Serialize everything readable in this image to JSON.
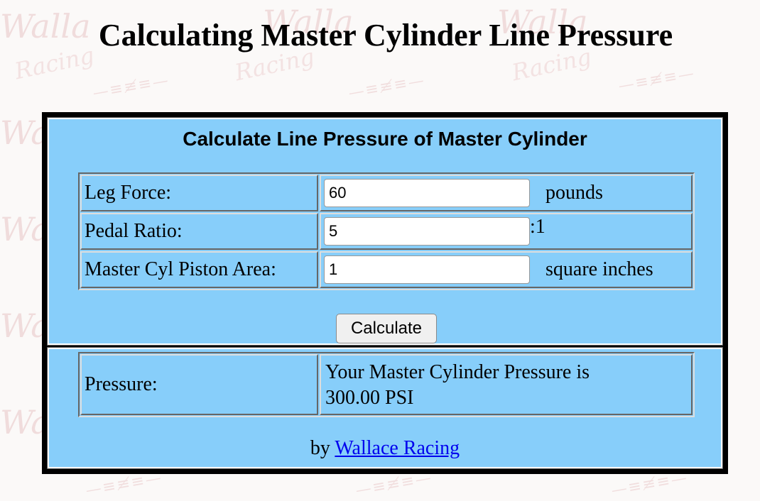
{
  "page": {
    "title": "Calculating Master Cylinder Line Pressure"
  },
  "calculator": {
    "heading": "Calculate Line Pressure of Master Cylinder",
    "fields": [
      {
        "label": "Leg Force:",
        "value": "60",
        "unit": "pounds"
      },
      {
        "label": "Pedal Ratio:",
        "value": "5",
        "unit": ":1"
      },
      {
        "label": "Master Cyl Piston Area:",
        "value": "1",
        "unit": "square inches"
      }
    ],
    "button_label": "Calculate"
  },
  "result": {
    "label": "Pressure:",
    "text_line1": "Your Master Cylinder Pressure is",
    "text_line2": "300.00 PSI"
  },
  "credit": {
    "prefix": "by",
    "link_text": "Wallace Racing"
  },
  "colors": {
    "panel_bg": "#87cefa",
    "frame": "#000000",
    "link": "#0000ee"
  }
}
